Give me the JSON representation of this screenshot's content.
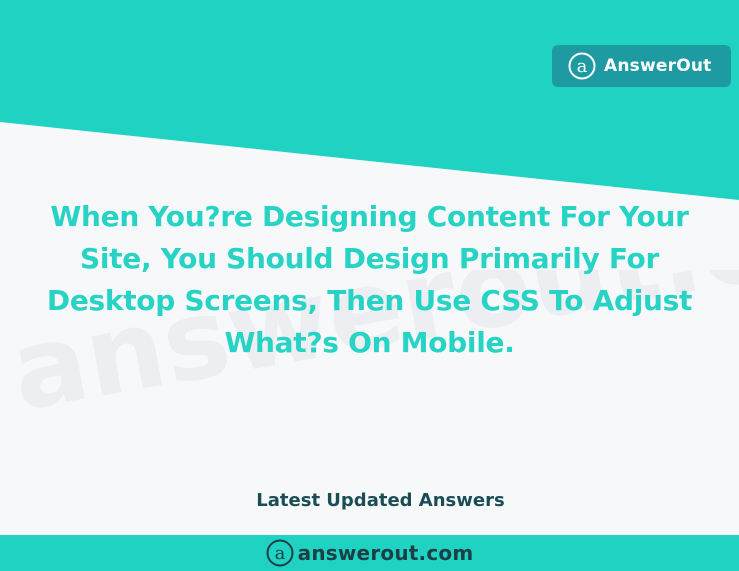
{
  "badge": {
    "brand_label": "AnswerOut",
    "icon": "a-circle-logo-icon"
  },
  "watermark_text": "answerout.com",
  "headline_lines": [
    "When You?re Designing Content For Your",
    "Site, You Should Design Primarily For",
    "Desktop Screens, Then Use CSS To Adjust",
    "What?s On Mobile."
  ],
  "section_label": "Latest Updated Answers",
  "footer": {
    "site_label": "answerout.com",
    "icon": "a-circle-logo-icon"
  },
  "colors": {
    "teal": "#1fd2c2",
    "badge_teal": "#1e9aa3",
    "headline": "#27d3c4",
    "section_label": "#1a4d55",
    "background": "#f7f8fa"
  }
}
